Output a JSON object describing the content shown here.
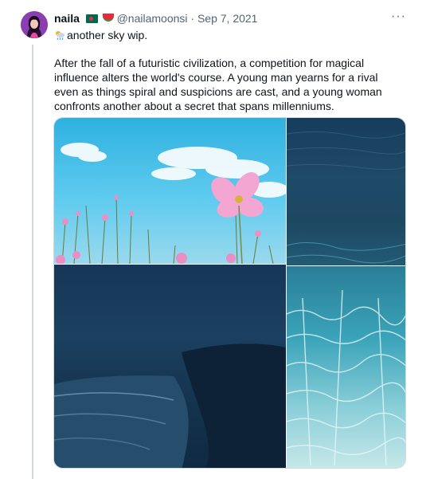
{
  "tweet": {
    "author_name": "naila",
    "handle": "@nailamoonsi",
    "separator": "·",
    "date": "Sep 7, 2021",
    "more_label": "···",
    "subtitle": "another sky wip.",
    "text": "After the fall of a futuristic civilization, a competition for magical influence alters the world's course. A young man yearns for a rival even as things spiral and suspicions are cast, and a young woman confronts another about a secret that spans millenniums."
  },
  "icons": {
    "flag": "bangladesh-flag-icon",
    "watermelon": "watermelon-icon",
    "weather": "sun-behind-rain-cloud-icon",
    "more": "more-icon"
  },
  "colors": {
    "avatar_bg": "#8a3fb0",
    "text": "#0f1419",
    "muted": "#536471",
    "rail": "#cfd9de"
  }
}
